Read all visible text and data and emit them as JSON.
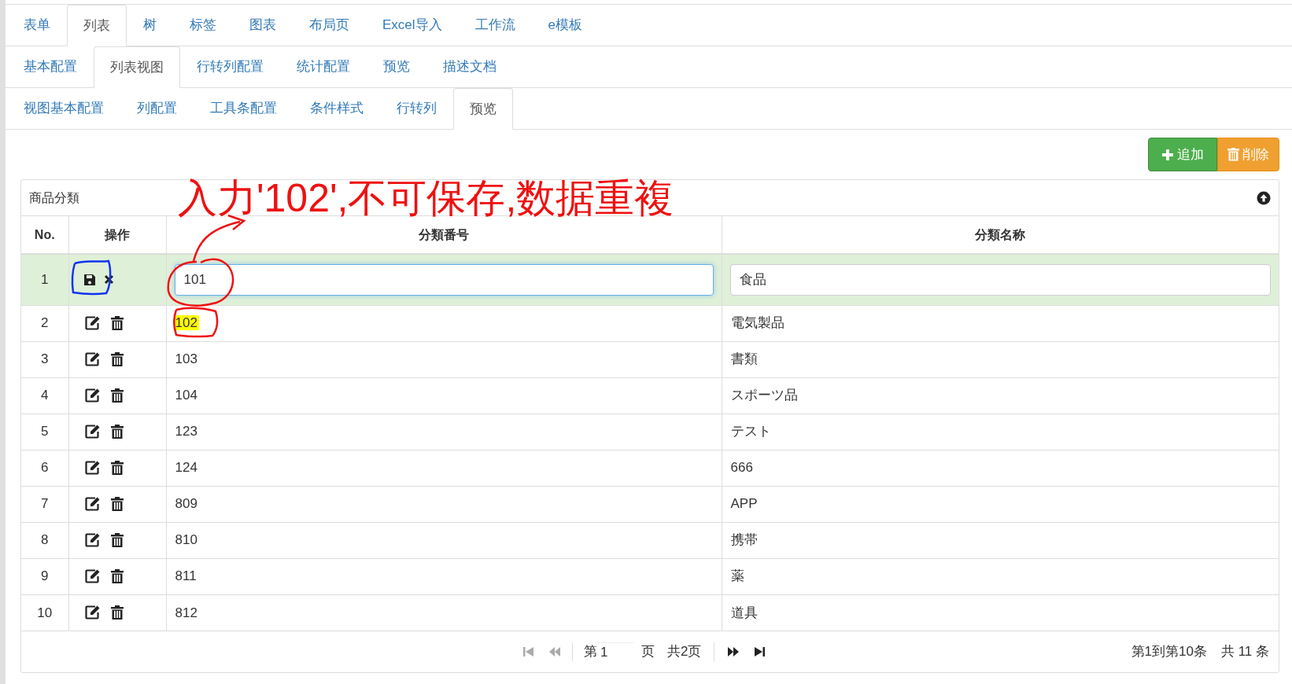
{
  "tabs_level1": [
    {
      "label": "表单",
      "selected": false
    },
    {
      "label": "列表",
      "selected": true
    },
    {
      "label": "树",
      "selected": false
    },
    {
      "label": "标签",
      "selected": false
    },
    {
      "label": "图表",
      "selected": false
    },
    {
      "label": "布局页",
      "selected": false
    },
    {
      "label": "Excel导入",
      "selected": false
    },
    {
      "label": "工作流",
      "selected": false
    },
    {
      "label": "e模板",
      "selected": false
    }
  ],
  "tabs_level2": [
    {
      "label": "基本配置",
      "selected": false
    },
    {
      "label": "列表视图",
      "selected": true
    },
    {
      "label": "行转列配置",
      "selected": false
    },
    {
      "label": "统计配置",
      "selected": false
    },
    {
      "label": "预览",
      "selected": false
    },
    {
      "label": "描述文档",
      "selected": false
    }
  ],
  "tabs_level3": [
    {
      "label": "视图基本配置",
      "selected": false
    },
    {
      "label": "列配置",
      "selected": false
    },
    {
      "label": "工具条配置",
      "selected": false
    },
    {
      "label": "条件样式",
      "selected": false
    },
    {
      "label": "行转列",
      "selected": false
    },
    {
      "label": "预览",
      "selected": true
    }
  ],
  "toolbar": {
    "add_button": "追加",
    "delete_button": "削除"
  },
  "panel": {
    "title": "商品分類",
    "table": {
      "columns": [
        "No.",
        "操作",
        "分類番号",
        "分類名称"
      ],
      "rows": [
        {
          "no": "1",
          "kind": "editing",
          "code": "101",
          "name": "食品",
          "highlighted": false
        },
        {
          "no": "2",
          "kind": "view",
          "code": "102",
          "name": "電気製品",
          "highlighted": true
        },
        {
          "no": "3",
          "kind": "view",
          "code": "103",
          "name": "書類",
          "highlighted": false
        },
        {
          "no": "4",
          "kind": "view",
          "code": "104",
          "name": "スポーツ品",
          "highlighted": false
        },
        {
          "no": "5",
          "kind": "view",
          "code": "123",
          "name": "テスト",
          "highlighted": false
        },
        {
          "no": "6",
          "kind": "view",
          "code": "124",
          "name": "666",
          "highlighted": false
        },
        {
          "no": "7",
          "kind": "view",
          "code": "809",
          "name": "APP",
          "highlighted": false
        },
        {
          "no": "8",
          "kind": "view",
          "code": "810",
          "name": "携帯",
          "highlighted": false
        },
        {
          "no": "9",
          "kind": "view",
          "code": "811",
          "name": "薬",
          "highlighted": false
        },
        {
          "no": "10",
          "kind": "view",
          "code": "812",
          "name": "道具",
          "highlighted": false
        }
      ]
    },
    "pagination": {
      "first_disabled": true,
      "prev_disabled": true,
      "next_disabled": false,
      "last_disabled": false,
      "page_prefix": "第",
      "page_value": "1",
      "page_suffix": "页",
      "total_pages": "共2页",
      "range": "第1到第10条",
      "total": "共 11 条"
    }
  },
  "annotation": {
    "text": "入力'102',不可保存,数据重複"
  }
}
